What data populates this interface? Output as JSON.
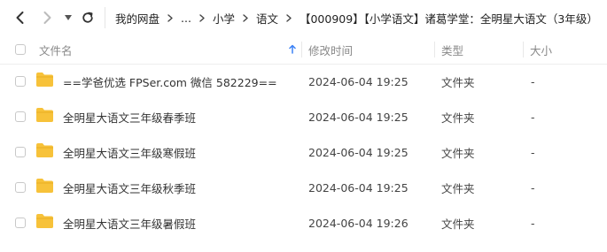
{
  "nav": {
    "breadcrumbs": [
      "我的网盘",
      "...",
      "小学",
      "语文",
      "【000909】【小学语文】诸葛学堂：全明星大语文（3年级）"
    ]
  },
  "table": {
    "columns": {
      "name": "文件名",
      "modified": "修改时间",
      "type": "类型",
      "size": "大小"
    },
    "sort": {
      "column": "name",
      "direction": "ascending"
    },
    "rows": [
      {
        "name": "==学爸优选 FPSer.com 微信 582229==",
        "modified": "2024-06-04 19:25",
        "type": "文件夹",
        "size": "-"
      },
      {
        "name": "全明星大语文三年级春季班",
        "modified": "2024-06-04 19:25",
        "type": "文件夹",
        "size": "-"
      },
      {
        "name": "全明星大语文三年级寒假班",
        "modified": "2024-06-04 19:25",
        "type": "文件夹",
        "size": "-"
      },
      {
        "name": "全明星大语文三年级秋季班",
        "modified": "2024-06-04 19:25",
        "type": "文件夹",
        "size": "-"
      },
      {
        "name": "全明星大语文三年级暑假班",
        "modified": "2024-06-04 19:26",
        "type": "文件夹",
        "size": "-"
      }
    ]
  },
  "colors": {
    "folder": "#f7c23a",
    "sort_accent": "#3b82f6"
  },
  "icons": {
    "back": "chevron-left-icon",
    "forward": "chevron-right-icon",
    "history": "caret-down-icon",
    "refresh": "refresh-icon",
    "folder": "folder-icon",
    "sort": "arrow-up-icon"
  }
}
